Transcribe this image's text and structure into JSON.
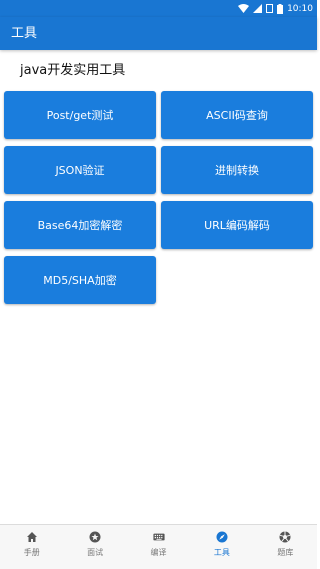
{
  "status_bar": {
    "time": "10:10"
  },
  "app_bar": {
    "title": "工具"
  },
  "section": {
    "title": "java开发实用工具"
  },
  "tools": [
    {
      "label": "Post/get测试"
    },
    {
      "label": "ASCII码查询"
    },
    {
      "label": "JSON验证"
    },
    {
      "label": "进制转换"
    },
    {
      "label": "Base64加密解密"
    },
    {
      "label": "URL编码解码"
    },
    {
      "label": "MD5/SHA加密"
    }
  ],
  "bottom_nav": {
    "items": [
      {
        "label": "手册",
        "icon": "home-icon"
      },
      {
        "label": "面试",
        "icon": "star-icon"
      },
      {
        "label": "编译",
        "icon": "keyboard-icon"
      },
      {
        "label": "工具",
        "icon": "compass-icon",
        "active": true
      },
      {
        "label": "题库",
        "icon": "aperture-icon"
      }
    ]
  },
  "colors": {
    "primary": "#1976d2",
    "button": "#1a7ddd"
  }
}
